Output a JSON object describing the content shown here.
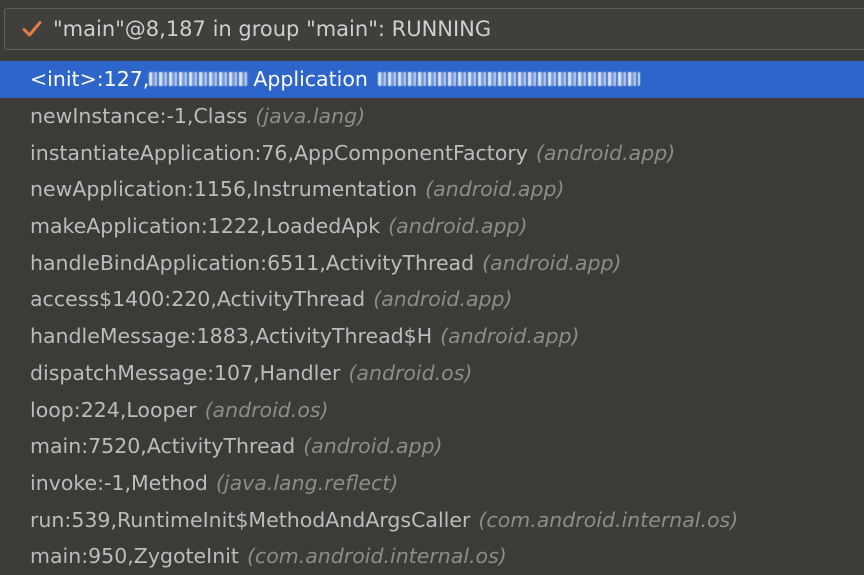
{
  "thread_selector": {
    "icon": "checkmark-icon",
    "label": "\"main\"@8,187 in group \"main\": RUNNING",
    "check_color": "#e07b4c"
  },
  "frames": [
    {
      "method": "<init>:127, ",
      "cls": "Application",
      "pkg": "",
      "selected": true
    },
    {
      "method": "newInstance:-1, ",
      "cls": "Class",
      "pkg": "(java.lang)"
    },
    {
      "method": "instantiateApplication:76, ",
      "cls": "AppComponentFactory",
      "pkg": "(android.app)"
    },
    {
      "method": "newApplication:1156, ",
      "cls": "Instrumentation",
      "pkg": "(android.app)"
    },
    {
      "method": "makeApplication:1222, ",
      "cls": "LoadedApk",
      "pkg": "(android.app)"
    },
    {
      "method": "handleBindApplication:6511, ",
      "cls": "ActivityThread",
      "pkg": "(android.app)"
    },
    {
      "method": "access$1400:220, ",
      "cls": "ActivityThread",
      "pkg": "(android.app)"
    },
    {
      "method": "handleMessage:1883, ",
      "cls": "ActivityThread$H",
      "pkg": "(android.app)"
    },
    {
      "method": "dispatchMessage:107, ",
      "cls": "Handler",
      "pkg": "(android.os)"
    },
    {
      "method": "loop:224, ",
      "cls": "Looper",
      "pkg": "(android.os)"
    },
    {
      "method": "main:7520, ",
      "cls": "ActivityThread",
      "pkg": "(android.app)"
    },
    {
      "method": "invoke:-1, ",
      "cls": "Method",
      "pkg": "(java.lang.reflect)"
    },
    {
      "method": "run:539, ",
      "cls": "RuntimeInit$MethodAndArgsCaller",
      "pkg": "(com.android.internal.os)"
    },
    {
      "method": "main:950, ",
      "cls": "ZygoteInit",
      "pkg": "(com.android.internal.os)"
    }
  ],
  "colors": {
    "background": "#3d3b38",
    "selection": "#2e65ca",
    "text": "#bcbcbc",
    "package_text": "#8d8c89"
  }
}
